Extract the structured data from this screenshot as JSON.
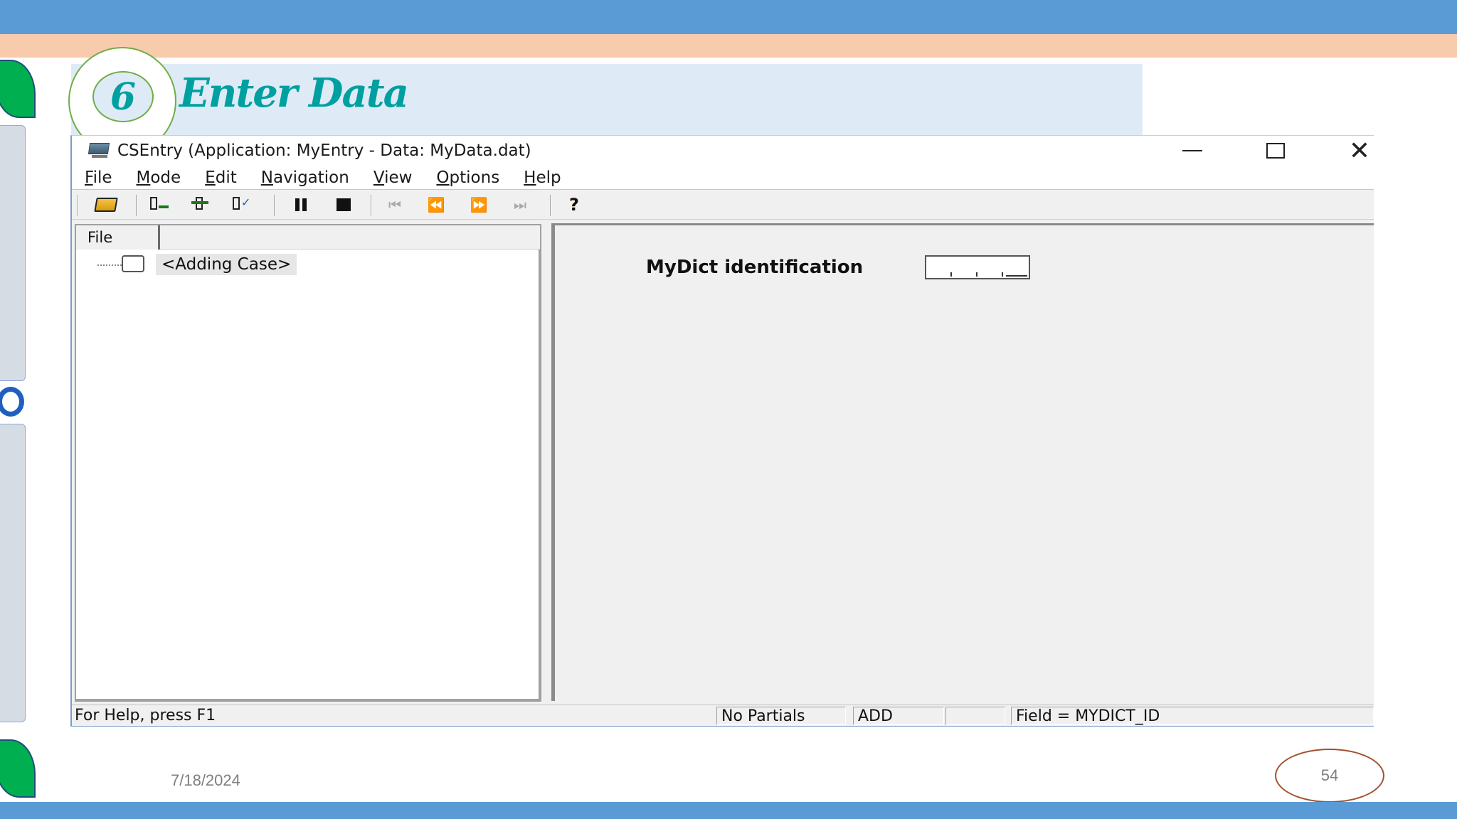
{
  "slide": {
    "step_number": "6",
    "title": "Enter Data",
    "date": "7/18/2024",
    "page_number": "54",
    "colors": {
      "top_bar": "#5b9bd5",
      "peach_bar": "#f8cbad",
      "title_band": "#deebf7",
      "accent_teal": "#00a0a0",
      "leaf_green": "#00b050"
    }
  },
  "window": {
    "title": "CSEntry (Application: MyEntry - Data: MyData.dat)",
    "controls": [
      "minimize-icon",
      "maximize-icon",
      "close-icon"
    ],
    "close_glyph": "✕"
  },
  "menu": {
    "items": [
      {
        "accel": "F",
        "rest": "ile"
      },
      {
        "accel": "M",
        "rest": "ode"
      },
      {
        "accel": "E",
        "rest": "dit"
      },
      {
        "accel": "N",
        "rest": "avigation"
      },
      {
        "accel": "V",
        "rest": "iew"
      },
      {
        "accel": "O",
        "rest": "ptions"
      },
      {
        "accel": "H",
        "rest": "elp"
      }
    ]
  },
  "toolbar": {
    "icons": [
      "open-folder-icon",
      "add-mode-icon",
      "insert-node-icon",
      "verify-icon",
      "pause-icon",
      "stop-icon",
      "first-case-icon",
      "previous-case-icon",
      "next-case-icon",
      "last-case-icon",
      "help-icon"
    ],
    "glyphs": {
      "first": "⏮",
      "prev": "⏪",
      "next": "⏩",
      "last": "⏭",
      "help": "?"
    }
  },
  "case_tree": {
    "tab_label": "File",
    "items": [
      {
        "label": "<Adding Case>"
      }
    ]
  },
  "form": {
    "field_label": "MyDict identification"
  },
  "status_bar": {
    "help_text": "For Help, press F1",
    "partials": "No Partials",
    "mode": "ADD",
    "empty": "",
    "field": "Field = MYDICT_ID"
  }
}
